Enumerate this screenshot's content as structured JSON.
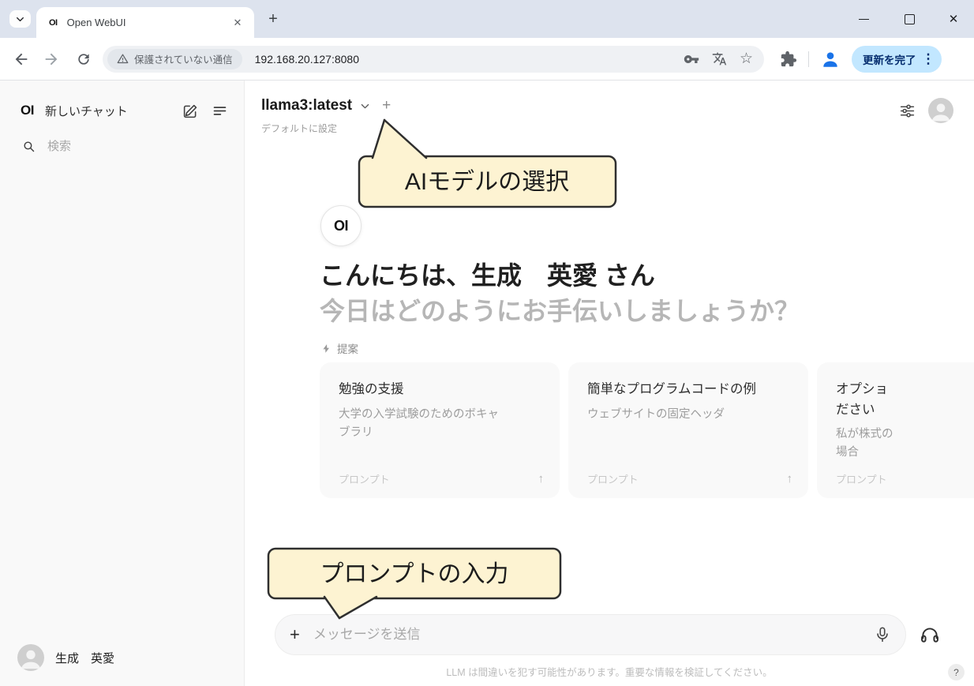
{
  "browser": {
    "tab": {
      "favicon": "OI",
      "title": "Open WebUI"
    },
    "nav": {
      "security_chip": "保護されていない通信",
      "url": "192.168.20.127:8080",
      "update_button": "更新を完了"
    }
  },
  "sidebar": {
    "logo": "OI",
    "new_chat_label": "新しいチャット",
    "search_placeholder": "検索",
    "user_name": "生成　英愛"
  },
  "main": {
    "model_name": "llama3:latest",
    "set_default_label": "デフォルトに設定",
    "greeting_logo": "OI",
    "greeting_title": "こんにちは、生成　英愛 さん",
    "greeting_subtitle": "今日はどのようにお手伝いしましょうか？",
    "suggestions_label": "提案",
    "cards": [
      {
        "title": [
          "勉強の支援"
        ],
        "subtitle": [
          "大学の入学試験のためのボキャ",
          "ブラリ"
        ],
        "footer": "プロンプト"
      },
      {
        "title": [
          "簡単なプログラムコードの例"
        ],
        "subtitle": [
          "ウェブサイトの固定ヘッダ"
        ],
        "footer": "プロンプト"
      },
      {
        "title": [
          "オプショ",
          "ださい"
        ],
        "subtitle": [
          "私が株式の",
          "場合"
        ],
        "footer": "プロンプト"
      }
    ],
    "input_placeholder": "メッセージを送信",
    "footer_note": "LLM は間違いを犯す可能性があります。重要な情報を検証してください。",
    "help_label": "?"
  },
  "annotations": {
    "model_callout": "AIモデルの選択",
    "prompt_callout": "プロンプトの入力"
  },
  "colors": {
    "callout_bg": "#fdf3d2",
    "callout_border": "#2f2f2f",
    "update_pill_bg": "#c2e7ff",
    "accent_blue": "#1a73e8"
  }
}
